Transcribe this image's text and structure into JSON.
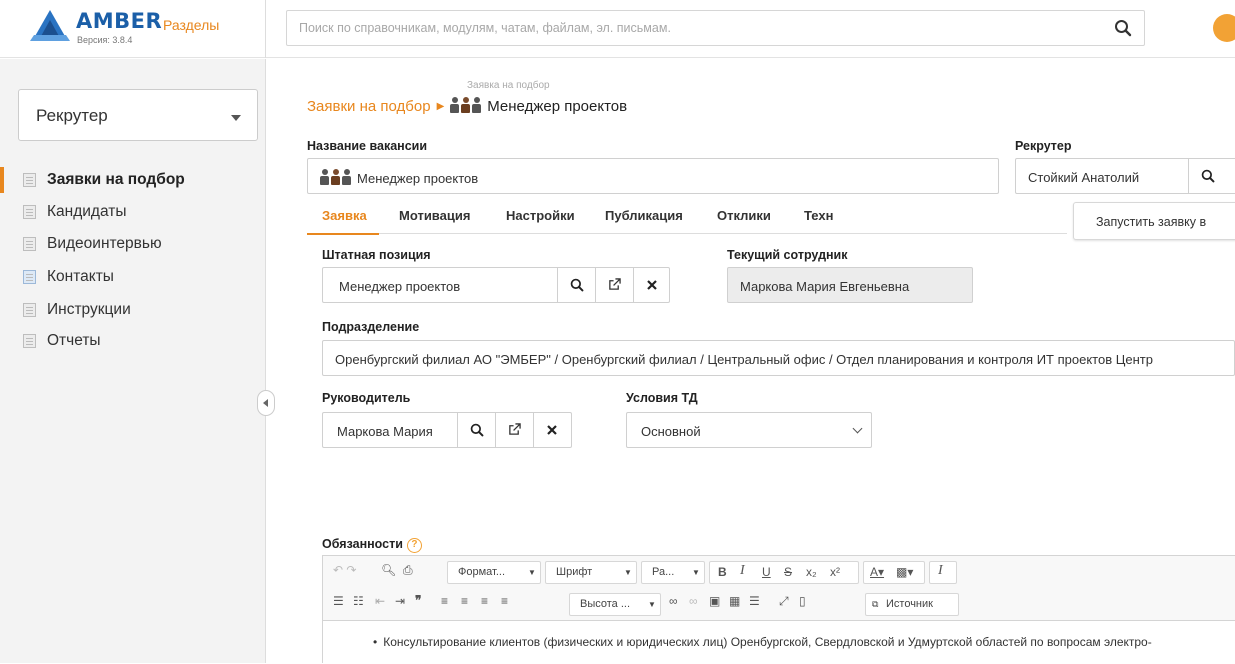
{
  "app": {
    "logo_text": "AMBER",
    "version": "Версия: 3.8.4",
    "sections_link": "Разделы"
  },
  "search": {
    "placeholder": "Поиск по справочникам, модулям, чатам, файлам, эл. письмам."
  },
  "sidebar": {
    "role": "Рекрутер",
    "items": [
      {
        "label": "Заявки на подбор",
        "active": true,
        "icon": "list-icon"
      },
      {
        "label": "Кандидаты",
        "active": false,
        "icon": "list-icon"
      },
      {
        "label": "Видеоинтервью",
        "active": false,
        "icon": "list-icon"
      },
      {
        "label": "Контакты",
        "active": false,
        "icon": "contacts-icon"
      },
      {
        "label": "Инструкции",
        "active": false,
        "icon": "list-icon"
      },
      {
        "label": "Отчеты",
        "active": false,
        "icon": "list-icon"
      }
    ]
  },
  "breadcrumb": {
    "small": "Заявка на подбор",
    "parent": "Заявки на подбор",
    "current": "Менеджер проектов"
  },
  "form": {
    "vacancy_label": "Название вакансии",
    "vacancy_value": "Менеджер проектов",
    "recruiter_label": "Рекрутер",
    "recruiter_value": "Стойкий Анатолий",
    "position_label": "Штатная позиция",
    "position_value": "Менеджер проектов",
    "current_employee_label": "Текущий сотрудник",
    "current_employee_value": "Маркова Мария Евгеньевна",
    "department_label": "Подразделение",
    "department_value": "Оренбургский филиал АО \"ЭМБЕР\" / Оренбургский филиал / Центральный офис / Отдел планирования и контроля ИТ проектов Центр",
    "manager_label": "Руководитель",
    "manager_value": "Маркова Мария",
    "terms_label": "Условия ТД",
    "terms_value": "Основной",
    "duties_label": "Обязанности"
  },
  "tabs": [
    "Заявка",
    "Мотивация",
    "Настройки",
    "Публикация",
    "Отклики",
    "Техн"
  ],
  "launch_button": "Запустить заявку в",
  "editor": {
    "format": "Формат...",
    "font": "Шрифт",
    "size": "Ра...",
    "height": "Высота ...",
    "source": "Источник",
    "content": "Консультирование клиентов (физических и юридических лиц) Оренбургской, Свердловской и Удмуртской областей по вопросам электро-"
  },
  "colors": {
    "accent": "#e8871e",
    "brand": "#1b5fa8"
  }
}
